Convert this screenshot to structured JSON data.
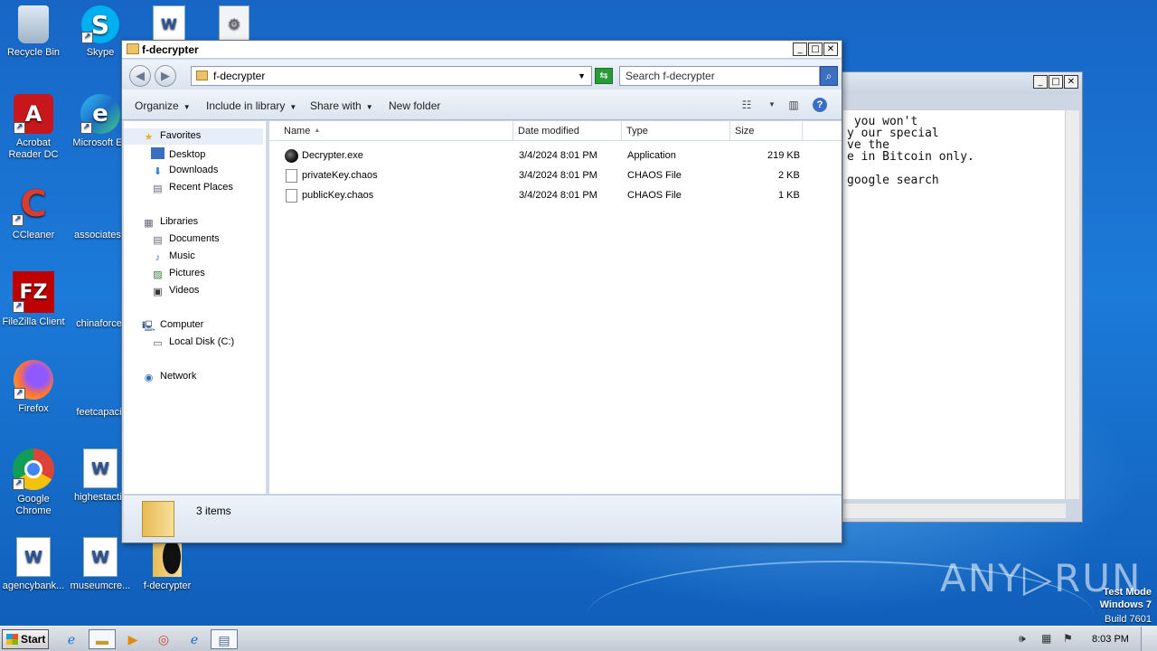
{
  "desktop": {
    "icons": [
      {
        "label": "Recycle Bin",
        "glyph": "🗑"
      },
      {
        "label": "Skype",
        "glyph": "S"
      },
      {
        "label": "Acrobat Reader DC",
        "glyph": "A"
      },
      {
        "label": "Microsoft Ed",
        "glyph": "e"
      },
      {
        "label": "CCleaner",
        "glyph": "C"
      },
      {
        "label": "associatese",
        "glyph": ""
      },
      {
        "label": "FileZilla Client",
        "glyph": "FZ"
      },
      {
        "label": "chinaforce.",
        "glyph": ""
      },
      {
        "label": "Firefox",
        "glyph": "🦊"
      },
      {
        "label": "feetcapacit",
        "glyph": ""
      },
      {
        "label": "Google Chrome",
        "glyph": "◎"
      },
      {
        "label": "highestactiv",
        "glyph": "W"
      },
      {
        "label": "agencybank...",
        "glyph": "W"
      },
      {
        "label": "museumcre...",
        "glyph": "W"
      },
      {
        "label": "f-decrypter",
        "glyph": ""
      }
    ],
    "accent_colors": {
      "wallpaper": "#1766c6",
      "acrobat": "#c8161d",
      "filezilla": "#bf0000",
      "chrome": "#db4437"
    }
  },
  "bg_window": {
    "lines": [
      " you won't",
      "y our special",
      "ve the",
      "e in Bitcoin only.",
      "",
      "google search"
    ]
  },
  "explorer": {
    "title": "f-decrypter",
    "address": "f-decrypter",
    "search_placeholder": "Search f-decrypter",
    "toolbar": {
      "organize": "Organize",
      "include_in_library": "Include in library",
      "share_with": "Share with",
      "new_folder": "New folder"
    },
    "nav": {
      "favorites": "Favorites",
      "desktop": "Desktop",
      "downloads": "Downloads",
      "recent_places": "Recent Places",
      "libraries": "Libraries",
      "documents": "Documents",
      "music": "Music",
      "pictures": "Pictures",
      "videos": "Videos",
      "computer": "Computer",
      "local_disk": "Local Disk (C:)",
      "network": "Network"
    },
    "columns": {
      "name": "Name",
      "date": "Date modified",
      "type": "Type",
      "size": "Size"
    },
    "files": [
      {
        "name": "Decrypter.exe",
        "date": "3/4/2024 8:01 PM",
        "type": "Application",
        "size": "219 KB",
        "icon": "app-icon"
      },
      {
        "name": "privateKey.chaos",
        "date": "3/4/2024 8:01 PM",
        "type": "CHAOS File",
        "size": "2 KB",
        "icon": "file-icon"
      },
      {
        "name": "publicKey.chaos",
        "date": "3/4/2024 8:01 PM",
        "type": "CHAOS File",
        "size": "1 KB",
        "icon": "file-icon"
      }
    ],
    "status": "3 items"
  },
  "taskbar": {
    "start": "Start",
    "clock": "8:03 PM"
  },
  "watermark": {
    "line1": "Test Mode",
    "line2": "Windows 7",
    "line3": "Build 7601",
    "brand": "ANY▷RUN"
  }
}
